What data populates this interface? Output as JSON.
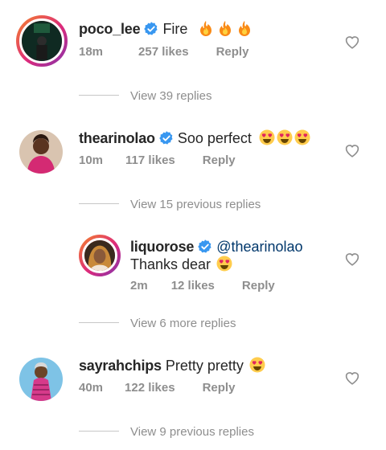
{
  "comments": [
    {
      "username": "poco_lee",
      "verified": true,
      "text": "Fire",
      "emoji": [
        "fire",
        "fire",
        "fire"
      ],
      "time": "18m",
      "likes": "257 likes",
      "reply": "Reply"
    },
    {
      "username": "thearinolao",
      "verified": true,
      "text": "Soo perfect",
      "emoji": [
        "heart-eyes",
        "heart-eyes",
        "heart-eyes"
      ],
      "time": "10m",
      "likes": "117 likes",
      "reply": "Reply"
    },
    {
      "username": "liquorose",
      "verified": true,
      "mention": "@thearinolao",
      "text": "Thanks dear",
      "emoji": [
        "heart-eyes"
      ],
      "time": "2m",
      "likes": "12 likes",
      "reply": "Reply"
    },
    {
      "username": "sayrahchips",
      "verified": false,
      "text": "Pretty pretty",
      "emoji": [
        "heart-eyes"
      ],
      "time": "40m",
      "likes": "122 likes",
      "reply": "Reply"
    }
  ],
  "view_replies": [
    "View 39 replies",
    "View 15 previous replies",
    "View 6 more replies",
    "View 9 previous replies"
  ],
  "colors": {
    "text": "#262626",
    "secondary": "#8e8e8e",
    "verified": "#3897f0",
    "mention": "#00376b"
  },
  "icons": [
    "verified-badge-icon",
    "fire-emoji-icon",
    "heart-eyes-emoji-icon",
    "like-heart-icon"
  ]
}
